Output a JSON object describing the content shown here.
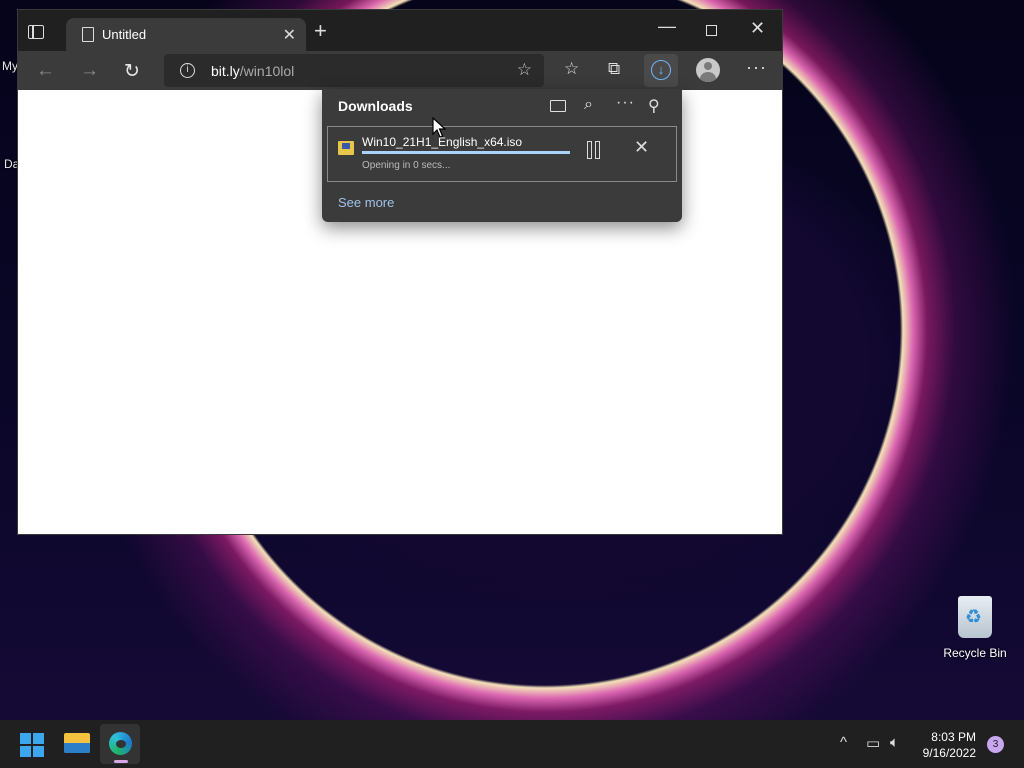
{
  "desktop": {
    "left_labels": [
      "My",
      "Da"
    ],
    "recycle_bin_label": "Recycle Bin"
  },
  "browser": {
    "tab": {
      "title": "Untitled",
      "close_glyph": "✕"
    },
    "new_tab_glyph": "+",
    "window_controls": {
      "minimize": "—",
      "close": "✕"
    },
    "toolbar": {
      "back_glyph": "←",
      "forward_glyph": "→",
      "reload_glyph": "↻",
      "info_glyph": "i",
      "url_host": "bit.ly",
      "url_path": "/win10lol",
      "menu_glyph": "···"
    }
  },
  "downloads": {
    "title": "Downloads",
    "more_glyph": "···",
    "item": {
      "file_name": "Win10_21H1_English_x64.iso",
      "status": "Opening in 0 secs...",
      "progress_pct": 100
    },
    "cancel_glyph": "✕",
    "see_more": "See more"
  },
  "taskbar": {
    "time": "8:03 PM",
    "date": "9/16/2022",
    "notification_count": "3",
    "chevron_glyph": "^"
  },
  "colors": {
    "accent": "#3ca6ee",
    "download_accent": "#6fb5f5",
    "link": "#9fc3e9"
  }
}
